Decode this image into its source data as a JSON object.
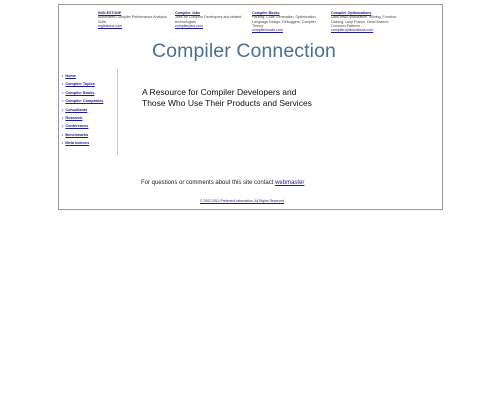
{
  "ads": [
    {
      "title": "INGLESTONE",
      "body": "Automated Compiler Performance Analysis Suite",
      "link": "inglestone.com"
    },
    {
      "title": "Compiler Jobs",
      "body": "Jobs for Compiler Developers and related technologists",
      "link": "compilerjobs.com"
    },
    {
      "title": "Compiler Books",
      "body": "Parsing, Code Generation, Optimization, Language Design, Debuggers, Compiler Theory",
      "link": "compilerbooks.com"
    },
    {
      "title": "Compiler Optimizations",
      "body": "Data-flow/Optimization, Inlining, Function Cloning, Loop Fusion, Dead Branch, Common Patterns ...",
      "link": "compileroptimizations.com"
    }
  ],
  "site": {
    "title": "Compiler Connection",
    "tagline_line1": "A Resource for Compiler Developers and",
    "tagline_line2": "Those Who Use Their Products and Services"
  },
  "sidebar": {
    "items": [
      {
        "label": "Home"
      },
      {
        "label": "Compiler Topics"
      },
      {
        "label": "Compiler Books"
      },
      {
        "label": "Compiler Companies"
      },
      {
        "label": "Consultants"
      },
      {
        "label": "Research"
      },
      {
        "label": "Conferences"
      },
      {
        "label": "Benchmarks"
      },
      {
        "label": "Meta Indexes"
      }
    ]
  },
  "contact": {
    "text": "For questions or comments about this site contact ",
    "link": "webmaster"
  },
  "footer": {
    "copyright": "© 2002-2010 Preferred Information, All Rights Reserved"
  }
}
